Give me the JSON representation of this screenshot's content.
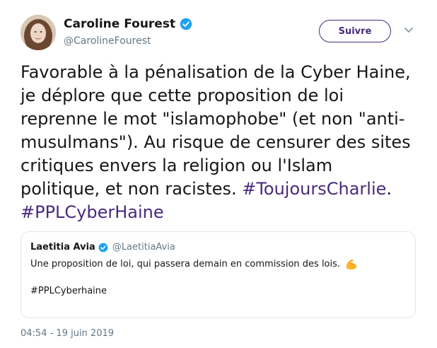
{
  "author": {
    "display_name": "Caroline Fourest",
    "handle": "@CarolineFourest",
    "verified": true
  },
  "follow_button": {
    "label": "Suivre"
  },
  "tweet": {
    "text_before_hashtags": "Favorable à la pénalisation de la Cyber Haine,\nje déplore que cette proposition de loi\nreprenne le mot \"islamophobe\" (et non \"anti-\nmusulmans\"). Au risque de censurer des sites\ncritiques envers la religion ou l'Islam\npolitique, et non racistes. ",
    "hashtag_1": "#ToujoursCharlie",
    "after_hashtag_1": ".\n",
    "hashtag_2": "#PPLCyberHaine"
  },
  "quoted_tweet": {
    "display_name": "Laetitia Avia",
    "handle": "@LaetitiaAvia",
    "verified": true,
    "text": "Une proposition de loi, qui passera demain en commission des lois.",
    "emoji_icon": "flexed-biceps-icon",
    "hashtag_line": "#PPLCyberhaine"
  },
  "timestamp": "04:54 - 19 juin 2019",
  "colors": {
    "accent": "#4a2a7b",
    "verified_blue": "#1da1f2",
    "secondary_text": "#657786",
    "border": "#e1e8ed"
  }
}
